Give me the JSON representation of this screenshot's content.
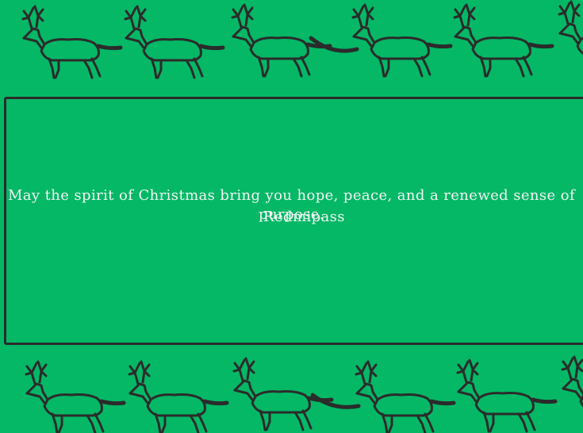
{
  "card": {
    "message_line1": "May the spirit of Christmas bring you hope, peace, and a renewed sense of",
    "message_line2": "purpose.",
    "sender": "Redmipass",
    "background_color": "#04b866",
    "text_color": "#f4f4f4",
    "outline_color": "#2b2b2b"
  },
  "decorations": {
    "top_border": "reindeer-row",
    "bottom_border": "reindeer-row"
  }
}
